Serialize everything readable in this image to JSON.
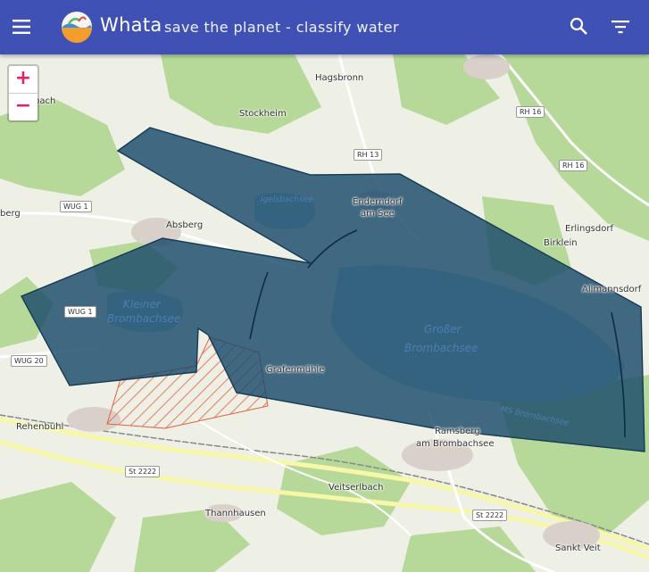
{
  "app": {
    "title": "Whata",
    "subtitle": "save the planet - classify water"
  },
  "toolbar": {
    "menu_icon": "menu-icon",
    "search_icon": "search-icon",
    "filter_icon": "filter-icon"
  },
  "zoom": {
    "in_label": "+",
    "out_label": "−"
  },
  "colors": {
    "appbar": "#3f51b5",
    "polygon_fill": "#1a4a6a",
    "hatch": "#e06040",
    "zoom_text": "#e91e63"
  },
  "map": {
    "places": [
      "Hagsbronn",
      "Stockheim",
      "bach",
      "berg",
      "Absberg",
      "Enderndorf",
      "am See",
      "Erlingsdorf",
      "Birklein",
      "Allmannsdorf",
      "Grafenmühle",
      "Rehenbühl",
      "Ramsberg",
      "am Brombachsee",
      "Veitserlbach",
      "Thannhausen",
      "Sankt Veit"
    ],
    "lakes": [
      "Igelsbachsee",
      "Kleiner",
      "Brombachsee",
      "Großer",
      "Brombachsee",
      "MS Brombachsee"
    ],
    "roads": [
      "RH 16",
      "RH 13",
      "RH 16",
      "WUG 1",
      "WUG 1",
      "WUG 20",
      "St 2222",
      "St 2222"
    ]
  }
}
